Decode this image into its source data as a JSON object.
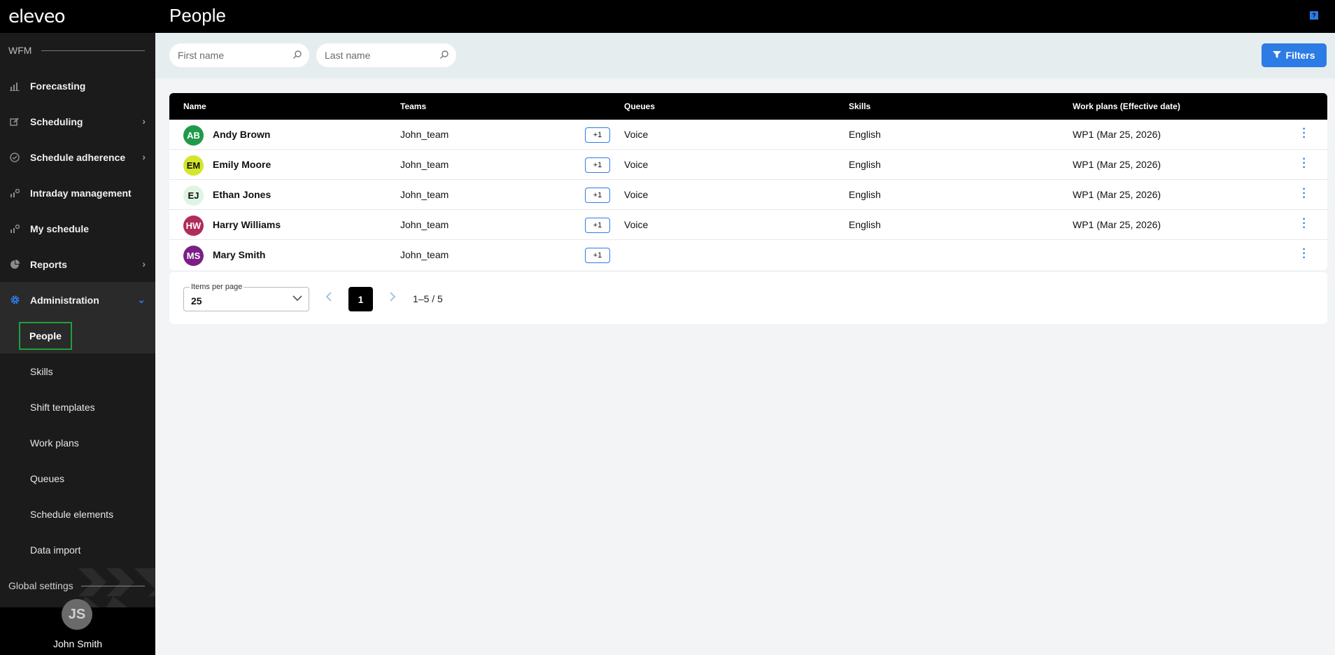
{
  "app": {
    "logo": "eleveo"
  },
  "sidebar": {
    "section_label": "WFM",
    "items": [
      {
        "label": "Forecasting",
        "icon": "bar-chart-icon",
        "has_chevron": false
      },
      {
        "label": "Scheduling",
        "icon": "edit-icon",
        "has_chevron": true
      },
      {
        "label": "Schedule adherence",
        "icon": "check-circle-icon",
        "has_chevron": true
      },
      {
        "label": "Intraday management",
        "icon": "chart-settings-icon",
        "has_chevron": false
      },
      {
        "label": "My schedule",
        "icon": "chart-settings-icon",
        "has_chevron": false
      },
      {
        "label": "Reports",
        "icon": "pie-chart-icon",
        "has_chevron": true
      },
      {
        "label": "Administration",
        "icon": "gear-icon",
        "has_chevron": true,
        "expanded": true
      }
    ],
    "sub_items": [
      "People",
      "Skills",
      "Shift templates",
      "Work plans",
      "Queues",
      "Schedule elements",
      "Data import"
    ],
    "global_settings": "Global settings",
    "user": {
      "initials": "JS",
      "name": "John Smith"
    }
  },
  "header": {
    "title": "People",
    "help": "?"
  },
  "filters": {
    "first_name_placeholder": "First name",
    "last_name_placeholder": "Last name",
    "filters_label": "Filters"
  },
  "table": {
    "columns": [
      "Name",
      "Teams",
      "Queues",
      "Skills",
      "Work plans (Effective date)"
    ],
    "rows": [
      {
        "initials": "AB",
        "name": "Andy Brown",
        "team": "John_team",
        "extra": "+1",
        "queue": "Voice",
        "skill": "English",
        "plan": "WP1 (Mar 25, 2026)",
        "color": "#1f9a4a",
        "text_color": "#ffffff"
      },
      {
        "initials": "EM",
        "name": "Emily Moore",
        "team": "John_team",
        "extra": "+1",
        "queue": "Voice",
        "skill": "English",
        "plan": "WP1 (Mar 25, 2026)",
        "color": "#d3e62c",
        "text_color": "#111111"
      },
      {
        "initials": "EJ",
        "name": "Ethan Jones",
        "team": "John_team",
        "extra": "+1",
        "queue": "Voice",
        "skill": "English",
        "plan": "WP1 (Mar 25, 2026)",
        "color": "#dff5e3",
        "text_color": "#111111"
      },
      {
        "initials": "HW",
        "name": "Harry Williams",
        "team": "John_team",
        "extra": "+1",
        "queue": "Voice",
        "skill": "English",
        "plan": "WP1 (Mar 25, 2026)",
        "color": "#b02c5c",
        "text_color": "#ffffff"
      },
      {
        "initials": "MS",
        "name": "Mary Smith",
        "team": "John_team",
        "extra": "+1",
        "queue": "",
        "skill": "",
        "plan": "",
        "color": "#7a1f86",
        "text_color": "#ffffff"
      }
    ]
  },
  "pagination": {
    "items_per_page_label": "Items per page",
    "items_per_page": "25",
    "current_page": "1",
    "range": "1–5 / 5"
  },
  "colors": {
    "accent": "#2d7be5",
    "selected_outline": "#1fa03d"
  }
}
